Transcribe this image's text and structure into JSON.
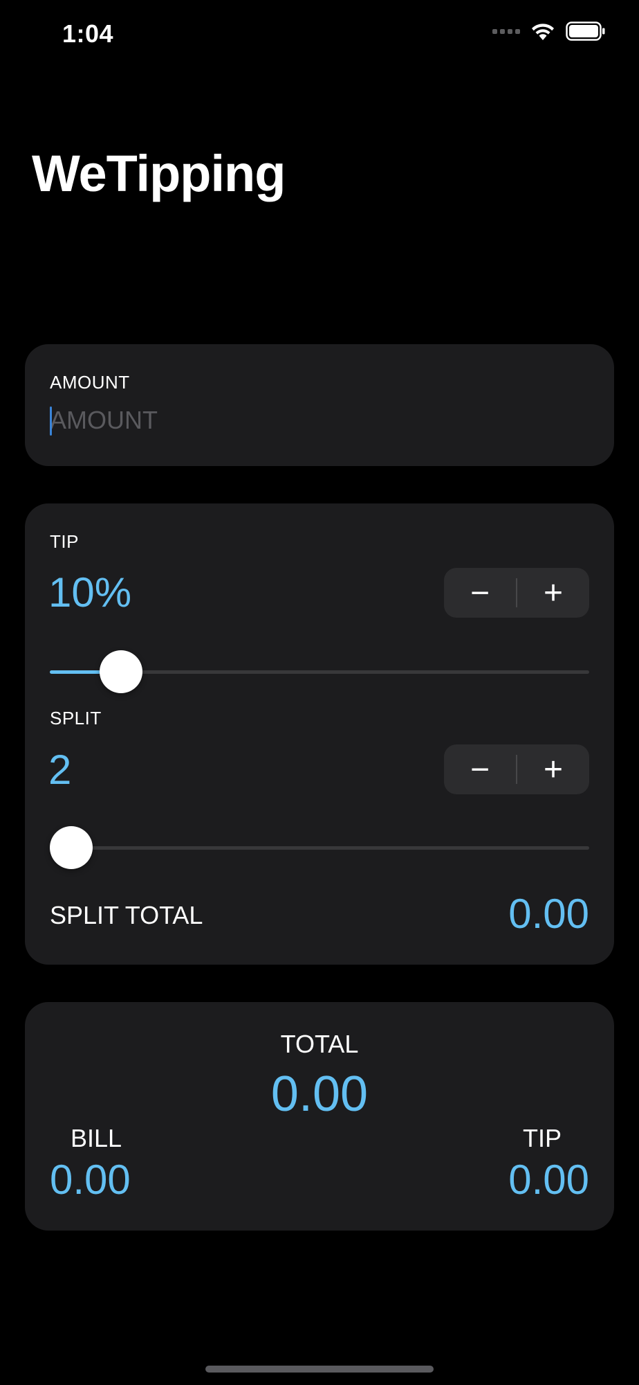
{
  "status_bar": {
    "time": "1:04",
    "icons": [
      "cellular-signal-icon",
      "wifi-icon",
      "battery-icon"
    ]
  },
  "app": {
    "title": "WeTipping"
  },
  "amount_card": {
    "label": "AMOUNT",
    "input_value": "",
    "placeholder": "AMOUNT"
  },
  "tip_card": {
    "tip_label": "TIP",
    "tip_value": "10%",
    "tip_slider_level": 0.1,
    "split_label": "SPLIT",
    "split_value": "2",
    "split_slider_level": 0.0,
    "stepper_minus": "−",
    "stepper_plus": "+",
    "split_total_label": "SPLIT TOTAL",
    "split_total_value": "0.00"
  },
  "total_card": {
    "total_label": "TOTAL",
    "total_value": "0.00",
    "bill_label": "BILL",
    "bill_value": "0.00",
    "tip_label": "TIP",
    "tip_value": "0.00"
  },
  "colors": {
    "background": "#000000",
    "card": "#1c1c1e",
    "accent": "#63bff2",
    "stepper_bg": "#2c2c2e",
    "placeholder": "#5a5a5e"
  }
}
